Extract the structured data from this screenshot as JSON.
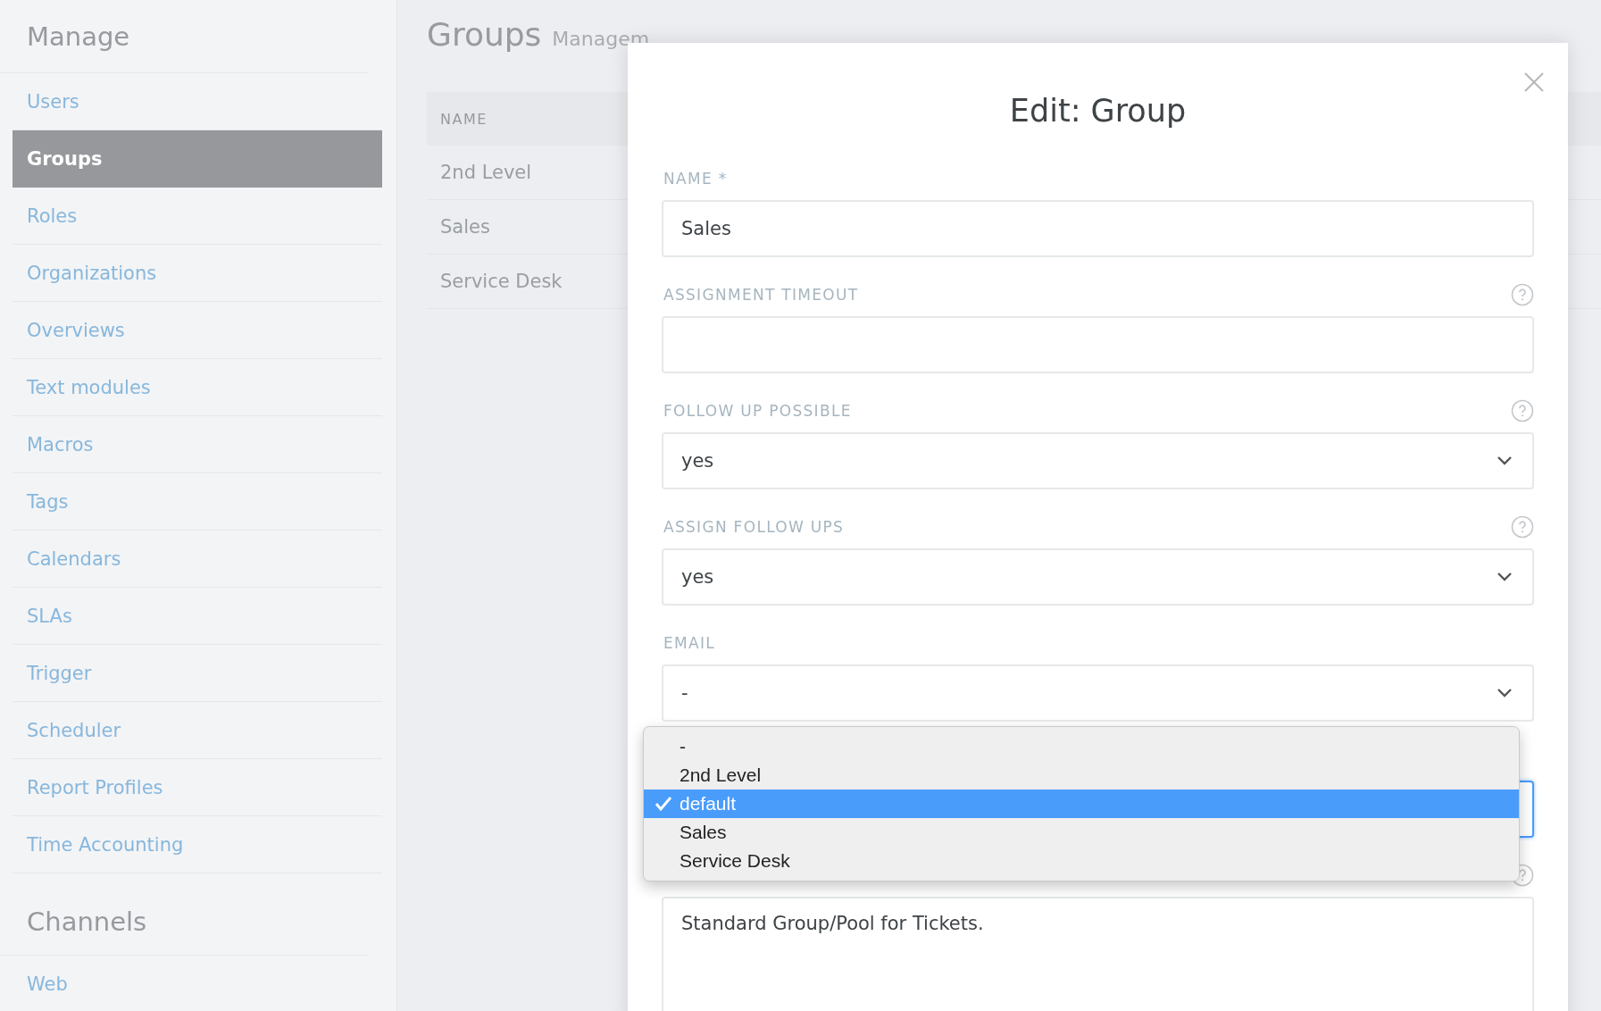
{
  "sidebar": {
    "sections": [
      {
        "heading": "Manage",
        "items": [
          {
            "label": "Users",
            "selected": false
          },
          {
            "label": "Groups",
            "selected": true
          },
          {
            "label": "Roles",
            "selected": false
          },
          {
            "label": "Organizations",
            "selected": false
          },
          {
            "label": "Overviews",
            "selected": false
          },
          {
            "label": "Text modules",
            "selected": false
          },
          {
            "label": "Macros",
            "selected": false
          },
          {
            "label": "Tags",
            "selected": false
          },
          {
            "label": "Calendars",
            "selected": false
          },
          {
            "label": "SLAs",
            "selected": false
          },
          {
            "label": "Trigger",
            "selected": false
          },
          {
            "label": "Scheduler",
            "selected": false
          },
          {
            "label": "Report Profiles",
            "selected": false
          },
          {
            "label": "Time Accounting",
            "selected": false
          }
        ]
      },
      {
        "heading": "Channels",
        "items": [
          {
            "label": "Web",
            "selected": false
          }
        ]
      }
    ]
  },
  "page": {
    "title": "Groups",
    "subtitle": "Managem"
  },
  "table": {
    "columns": [
      "NAME"
    ],
    "rows": [
      [
        "2nd Level"
      ],
      [
        "Sales"
      ],
      [
        "Service Desk"
      ]
    ]
  },
  "modal": {
    "title": "Edit: Group",
    "fields": [
      {
        "label": "NAME *",
        "help": false,
        "kind": "input",
        "value": "Sales",
        "focused": false
      },
      {
        "label": "ASSIGNMENT TIMEOUT",
        "help": true,
        "kind": "input",
        "focused": false
      },
      {
        "label": "FOLLOW UP POSSIBLE",
        "help": true,
        "kind": "select",
        "value": "yes",
        "focused": false
      },
      {
        "label": "ASSIGN FOLLOW UPS",
        "help": true,
        "kind": "select",
        "value": "yes",
        "focused": false
      },
      {
        "label": "EMAIL",
        "help": false,
        "kind": "select",
        "value": "-",
        "focused": false
      },
      {
        "help": false,
        "kind": "select",
        "focused": true
      },
      {
        "help": true,
        "kind": "textarea",
        "value": "Standard Group/Pool for Tickets.",
        "focused": false
      }
    ],
    "dropdown": {
      "options": [
        {
          "label": "-",
          "selected": false
        },
        {
          "label": "2nd Level",
          "selected": false
        },
        {
          "label": "default",
          "selected": true
        },
        {
          "label": "Sales",
          "selected": false
        },
        {
          "label": "Service Desk",
          "selected": false
        }
      ]
    }
  }
}
